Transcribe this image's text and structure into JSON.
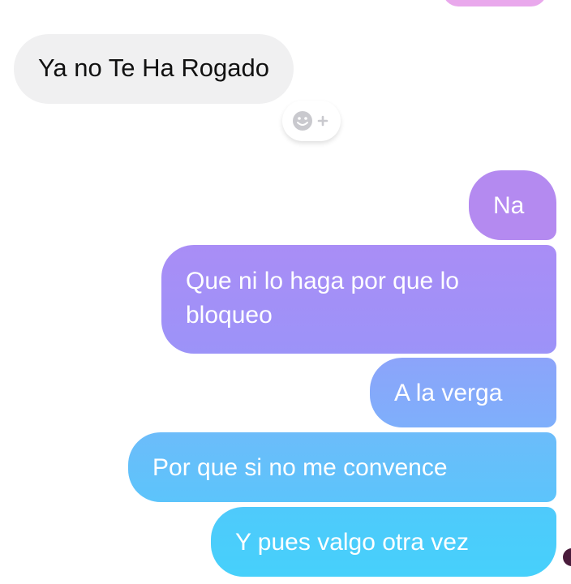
{
  "conversation": {
    "incoming": [
      {
        "text": "Ya no Te Ha Rogado"
      }
    ],
    "outgoing": [
      {
        "text": "Na"
      },
      {
        "text": "Que ni lo haga por que lo bloqueo"
      },
      {
        "text": "A la verga"
      },
      {
        "text": "Por que si no me convence"
      },
      {
        "text": "Y pues valgo otra vez"
      }
    ]
  },
  "reaction": {
    "icon": "add-reaction-icon"
  },
  "colors": {
    "incoming_bg": "#f0f0f1",
    "outgoing_gradient_top": "#b48af0",
    "outgoing_gradient_bottom": "#46d0fb"
  }
}
